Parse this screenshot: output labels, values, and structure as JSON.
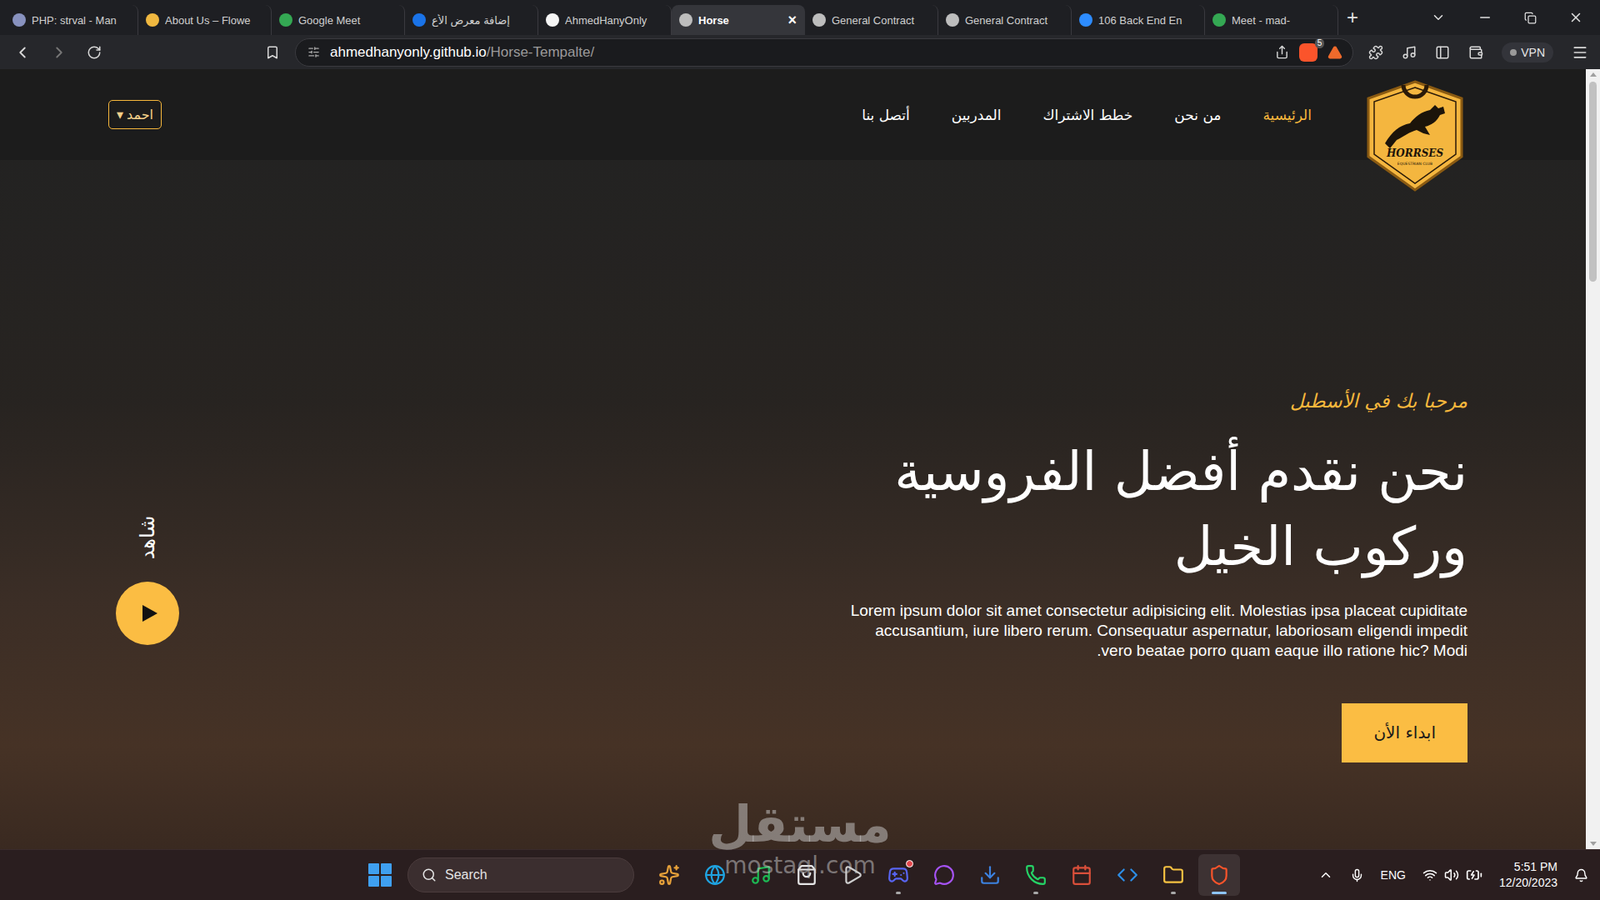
{
  "browser": {
    "tabs": [
      {
        "label": "PHP: strval - Man",
        "selected": false,
        "color": "#8892bf"
      },
      {
        "label": "About Us – Flowe",
        "selected": false,
        "color": "#f0b840"
      },
      {
        "label": "Google Meet",
        "selected": false,
        "color": "#34a853"
      },
      {
        "label": "إضافة معرض الأع",
        "selected": false,
        "color": "#1a73e8"
      },
      {
        "label": "AhmedHanyOnly",
        "selected": false,
        "color": "#f5f5f5"
      },
      {
        "label": "Horse",
        "selected": true,
        "color": "#bdbdbd"
      },
      {
        "label": "General Contract",
        "selected": false,
        "color": "#bdbdbd"
      },
      {
        "label": "General Contract",
        "selected": false,
        "color": "#bdbdbd"
      },
      {
        "label": "106 Back End En",
        "selected": false,
        "color": "#2d8cff"
      },
      {
        "label": "Meet - mad-",
        "selected": false,
        "color": "#34a853"
      }
    ],
    "close_tab": "×",
    "new_tab": "+",
    "address": {
      "host": "ahmedhanyonly.github.io",
      "path": "/Horse-Tempalte/"
    },
    "shields_count": "5",
    "vpn": "VPN"
  },
  "page": {
    "logo": {
      "name": "HORRSES",
      "tagline": "EQUESTRIAN CLUB"
    },
    "nav": [
      {
        "label": "الرئيسية",
        "selected": true
      },
      {
        "label": "من نحن",
        "selected": false
      },
      {
        "label": "خطط الاشتراك",
        "selected": false
      },
      {
        "label": "المدربين",
        "selected": false
      },
      {
        "label": "أتصل بنا",
        "selected": false
      }
    ],
    "user_menu": {
      "label": "احمد",
      "arrow": "▾"
    },
    "hero": {
      "eyebrow": "مرحبا بك في الأسطبل",
      "title_lines": [
        "نحن نقدم أفضل الفروسية",
        "وركوب الخيل"
      ],
      "text": "Lorem ipsum dolor sit amet consectetur adipisicing elit. Molestias ipsa placeat cupiditate accusantium, iure libero rerum. Consequatur aspernatur, laboriosam eligendi impedit vero beatae porro quam eaque illo ratione hic? Modi.",
      "cta": "ابداء الأن",
      "watch": "شاهد"
    }
  },
  "watermark": {
    "arabic": "مستقل",
    "latin": "mostaql.com"
  },
  "taskbar": {
    "search": "Search",
    "apps": [
      {
        "running": false,
        "selected": false,
        "notification": false,
        "color": "#e8a23a"
      },
      {
        "running": false,
        "selected": false,
        "notification": false,
        "color": "#1fa3e0"
      },
      {
        "running": false,
        "selected": false,
        "notification": false,
        "color": "#1db954"
      },
      {
        "running": false,
        "selected": false,
        "notification": false,
        "color": "#e6e6e6"
      },
      {
        "running": false,
        "selected": false,
        "notification": false,
        "color": "#cfcfcf"
      },
      {
        "running": true,
        "selected": false,
        "notification": true,
        "color": "#5865f2"
      },
      {
        "running": false,
        "selected": false,
        "notification": false,
        "color": "#a653f5"
      },
      {
        "running": false,
        "selected": false,
        "notification": false,
        "color": "#3c82e0"
      },
      {
        "running": true,
        "selected": false,
        "notification": false,
        "color": "#25d366"
      },
      {
        "running": false,
        "selected": false,
        "notification": false,
        "color": "#d94f3a"
      },
      {
        "running": false,
        "selected": false,
        "notification": false,
        "color": "#2d8ee6"
      },
      {
        "running": true,
        "selected": false,
        "notification": false,
        "color": "#f5c242"
      },
      {
        "running": true,
        "selected": true,
        "notification": false,
        "color": "#fb542b"
      }
    ],
    "language": "ENG",
    "time": "5:51 PM",
    "date": "12/20/2023"
  }
}
